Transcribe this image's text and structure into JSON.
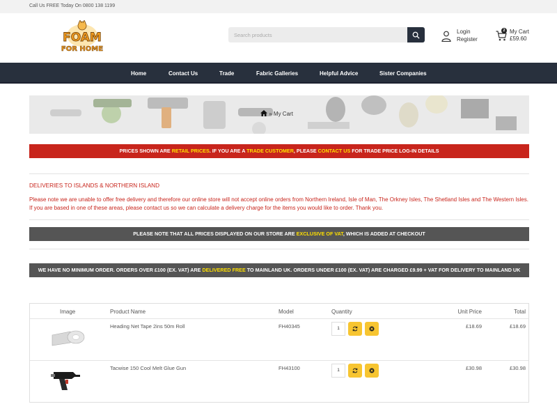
{
  "topbar": {
    "phone_text": "Call Us FREE Today On 0800 138 1199"
  },
  "header": {
    "logo_text_line1": "FOAM",
    "logo_text_line2": "FOR HOME",
    "search_placeholder": "Search products",
    "account": {
      "login": "Login",
      "register": "Register"
    },
    "cart": {
      "title": "My Cart",
      "total": "£59.60",
      "count": "2"
    }
  },
  "nav": {
    "items": [
      {
        "label": "Home"
      },
      {
        "label": "Contact Us"
      },
      {
        "label": "Trade"
      },
      {
        "label": "Fabric Galleries"
      },
      {
        "label": "Helpful Advice"
      },
      {
        "label": "Sister Companies"
      }
    ]
  },
  "breadcrumb": {
    "separator": "»",
    "current": "My Cart"
  },
  "notice_retail": {
    "part1": "PRICES SHOWN ARE ",
    "highlight1": "RETAIL PRICES",
    "part2": ". IF YOU ARE A ",
    "highlight2": "TRADE CUSTOMER",
    "part3": ", PLEASE ",
    "highlight3": "CONTACT US",
    "part4": " FOR TRADE PRICE LOG-IN DETAILS"
  },
  "delivery": {
    "title": "DELIVERIES TO ISLANDS & NORTHERN ISLAND",
    "text": "Please note we are unable to offer free delivery and therefore our online store will not accept online orders from Northern Ireland, Isle of Man, The Orkney Isles, The Shetland Isles and The Western Isles. If you are based in one of these areas, please contact us so we can calculate a delivery charge for the items you would like to order. Thank you."
  },
  "notice_vat": {
    "part1": "PLEASE NOTE THAT ALL PRICES DISPLAYED ON OUR STORE ARE ",
    "highlight": "EXCLUSIVE OF VAT",
    "part2": ", WHICH IS ADDED AT CHECKOUT"
  },
  "notice_order": {
    "part1": "WE HAVE NO MINIMUM ORDER. ORDERS OVER £100 (EX. VAT) ARE ",
    "highlight": "DELIVERED FREE",
    "part2": " TO MAINLAND UK. ORDERS UNDER £100 (EX. VAT) ARE CHARGED £9.99 + VAT FOR DELIVERY TO MAINLAND UK"
  },
  "cart_table": {
    "headers": {
      "image": "Image",
      "product_name": "Product Name",
      "model": "Model",
      "quantity": "Quantity",
      "unit_price": "Unit Price",
      "total": "Total"
    },
    "rows": [
      {
        "name": "Heading Net Tape 2ins 50m Roll",
        "model": "FH40345",
        "quantity": "1",
        "unit_price": "£18.69",
        "total": "£18.69",
        "image_icon": "tape-roll-image"
      },
      {
        "name": "Tacwise 150 Cool Melt Glue Gun",
        "model": "FH43100",
        "quantity": "1",
        "unit_price": "£30.98",
        "total": "£30.98",
        "image_icon": "glue-gun-image"
      }
    ]
  },
  "colors": {
    "nav_bg": "#28303d",
    "red_notice": "#c8251c",
    "grey_notice": "#555555",
    "highlight_yellow": "#ffe000",
    "button_yellow": "#f7c531",
    "logo_orange": "#f39c1f"
  }
}
